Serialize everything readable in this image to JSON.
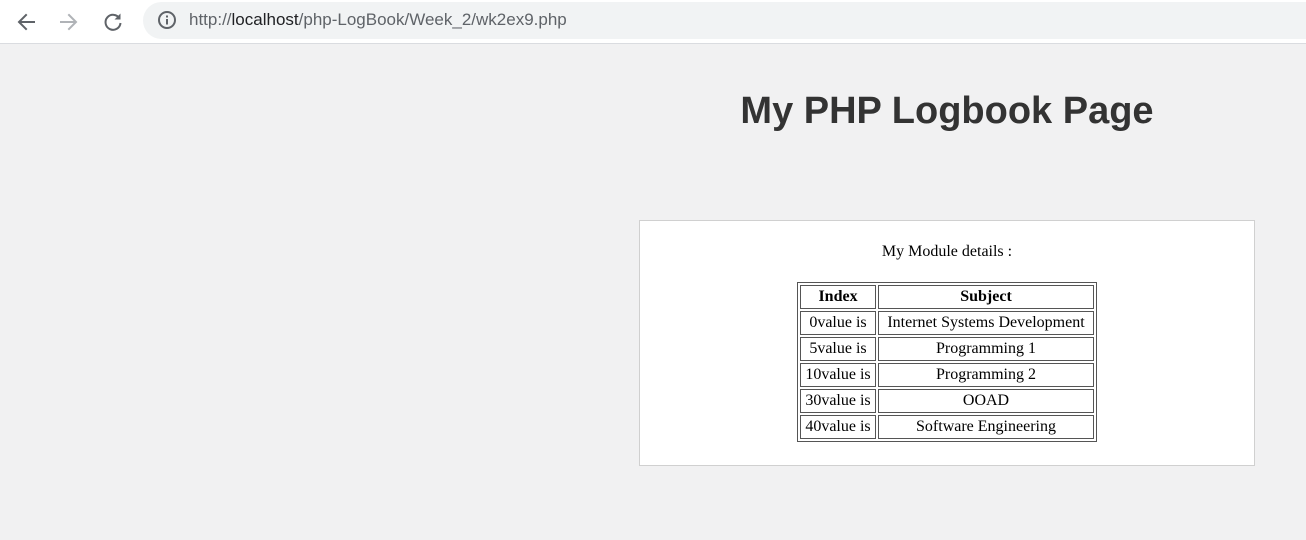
{
  "browser": {
    "url_prefix": "http://",
    "url_host": "localhost",
    "url_path": "/php-LogBook/Week_2/wk2ex9.php",
    "icons": {
      "back": "arrow-left-icon",
      "forward": "arrow-right-icon",
      "reload": "reload-icon",
      "info": "info-icon"
    }
  },
  "page": {
    "title": "My PHP Logbook Page",
    "caption": "My Module details :",
    "table": {
      "headers": [
        "Index",
        "Subject"
      ],
      "rows": [
        {
          "index": "0value is",
          "subject": "Internet Systems Development"
        },
        {
          "index": "5value is",
          "subject": "Programming 1"
        },
        {
          "index": "10value is",
          "subject": "Programming 2"
        },
        {
          "index": "30value is",
          "subject": "OOAD"
        },
        {
          "index": "40value is",
          "subject": "Software Engineering"
        }
      ]
    }
  }
}
